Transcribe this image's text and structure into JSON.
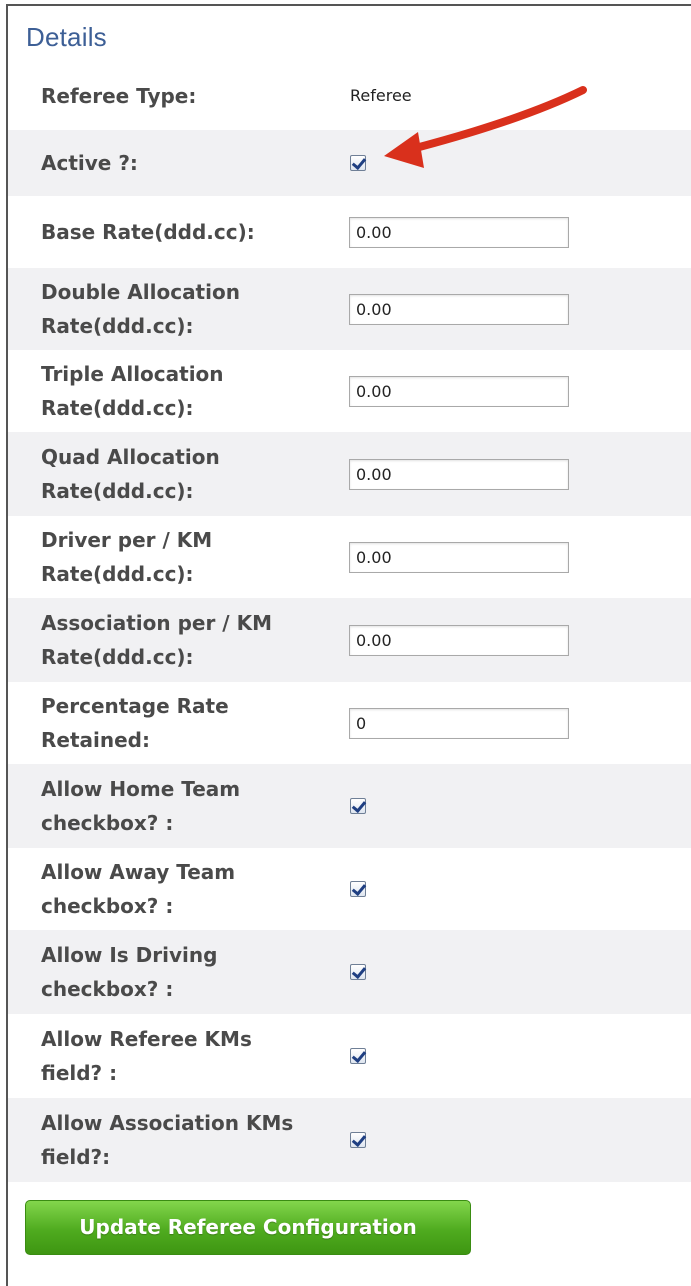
{
  "section_title": "Details",
  "fields": [
    {
      "label": "Referee Type:",
      "kind": "static",
      "value": "Referee"
    },
    {
      "label": "Active ?:",
      "kind": "checkbox",
      "checked": true
    },
    {
      "label": "Base Rate(ddd.cc):",
      "kind": "text",
      "value": "0.00"
    },
    {
      "label": "Double Allocation Rate(ddd.cc):",
      "kind": "text",
      "value": "0.00"
    },
    {
      "label": "Triple Allocation Rate(ddd.cc):",
      "kind": "text",
      "value": "0.00"
    },
    {
      "label": "Quad Allocation Rate(ddd.cc):",
      "kind": "text",
      "value": "0.00"
    },
    {
      "label": "Driver per / KM Rate(ddd.cc):",
      "kind": "text",
      "value": "0.00"
    },
    {
      "label": "Association per / KM Rate(ddd.cc):",
      "kind": "text",
      "value": "0.00"
    },
    {
      "label": "Percentage Rate Retained:",
      "kind": "text",
      "value": "0"
    },
    {
      "label": "Allow Home Team checkbox? :",
      "kind": "checkbox",
      "checked": true
    },
    {
      "label": "Allow Away Team checkbox? :",
      "kind": "checkbox",
      "checked": true
    },
    {
      "label": "Allow Is Driving checkbox? :",
      "kind": "checkbox",
      "checked": true
    },
    {
      "label": "Allow Referee KMs field? :",
      "kind": "checkbox",
      "checked": true
    },
    {
      "label": "Allow Association KMs field?:",
      "kind": "checkbox",
      "checked": true
    }
  ],
  "update_button_label": "Update Referee Configuration",
  "colors": {
    "title": "#3d5f96",
    "row_alt": "#f1f1f3",
    "button": "#4fab1f",
    "annotation_arrow": "#d9301c"
  },
  "annotation": {
    "type": "arrow",
    "target": "Active ?: checkbox"
  }
}
